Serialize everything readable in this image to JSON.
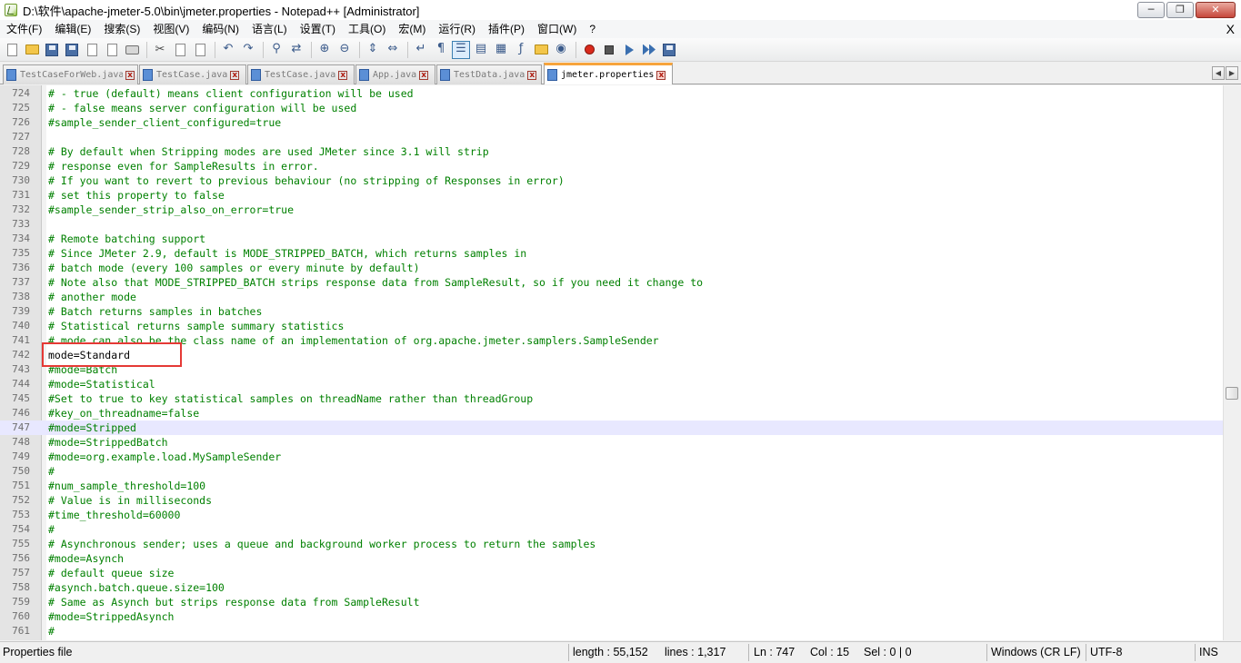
{
  "window": {
    "title": "D:\\软件\\apache-jmeter-5.0\\bin\\jmeter.properties - Notepad++ [Administrator]",
    "minimize": "─",
    "maximize": "❐",
    "close": "✕"
  },
  "menu": {
    "items": [
      "文件(F)",
      "编辑(E)",
      "搜索(S)",
      "视图(V)",
      "编码(N)",
      "语言(L)",
      "设置(T)",
      "工具(O)",
      "宏(M)",
      "运行(R)",
      "插件(P)",
      "窗口(W)",
      "?"
    ],
    "close_doc": "X"
  },
  "tabs": [
    {
      "label": "TestCaseForWeb.java",
      "active": false
    },
    {
      "label": "TestCase.java",
      "active": false
    },
    {
      "label": "TestCase.java",
      "active": false
    },
    {
      "label": "App.java",
      "active": false
    },
    {
      "label": "TestData.java",
      "active": false
    },
    {
      "label": "jmeter.properties",
      "active": true
    }
  ],
  "tab_nav": {
    "prev": "◀",
    "next": "▶"
  },
  "editor": {
    "current_line": "747",
    "highlighted_line": "742",
    "lines": [
      {
        "n": "724",
        "t": "# - true (default) means client configuration will be used"
      },
      {
        "n": "725",
        "t": "# - false means server configuration will be used"
      },
      {
        "n": "726",
        "t": "#sample_sender_client_configured=true"
      },
      {
        "n": "727",
        "t": ""
      },
      {
        "n": "728",
        "t": "# By default when Stripping modes are used JMeter since 3.1 will strip"
      },
      {
        "n": "729",
        "t": "# response even for SampleResults in error."
      },
      {
        "n": "730",
        "t": "# If you want to revert to previous behaviour (no stripping of Responses in error)"
      },
      {
        "n": "731",
        "t": "# set this property to false"
      },
      {
        "n": "732",
        "t": "#sample_sender_strip_also_on_error=true"
      },
      {
        "n": "733",
        "t": ""
      },
      {
        "n": "734",
        "t": "# Remote batching support"
      },
      {
        "n": "735",
        "t": "# Since JMeter 2.9, default is MODE_STRIPPED_BATCH, which returns samples in"
      },
      {
        "n": "736",
        "t": "# batch mode (every 100 samples or every minute by default)"
      },
      {
        "n": "737",
        "t": "# Note also that MODE_STRIPPED_BATCH strips response data from SampleResult, so if you need it change to"
      },
      {
        "n": "738",
        "t": "# another mode"
      },
      {
        "n": "739",
        "t": "# Batch returns samples in batches"
      },
      {
        "n": "740",
        "t": "# Statistical returns sample summary statistics"
      },
      {
        "n": "741",
        "t": "# mode can also be the class name of an implementation of org.apache.jmeter.samplers.SampleSender"
      },
      {
        "n": "742",
        "t": "mode=Standard"
      },
      {
        "n": "743",
        "t": "#mode=Batch"
      },
      {
        "n": "744",
        "t": "#mode=Statistical"
      },
      {
        "n": "745",
        "t": "#Set to true to key statistical samples on threadName rather than threadGroup"
      },
      {
        "n": "746",
        "t": "#key_on_threadname=false"
      },
      {
        "n": "747",
        "t": "#mode=Stripped"
      },
      {
        "n": "748",
        "t": "#mode=StrippedBatch"
      },
      {
        "n": "749",
        "t": "#mode=org.example.load.MySampleSender"
      },
      {
        "n": "750",
        "t": "#"
      },
      {
        "n": "751",
        "t": "#num_sample_threshold=100"
      },
      {
        "n": "752",
        "t": "# Value is in milliseconds"
      },
      {
        "n": "753",
        "t": "#time_threshold=60000"
      },
      {
        "n": "754",
        "t": "#"
      },
      {
        "n": "755",
        "t": "# Asynchronous sender; uses a queue and background worker process to return the samples"
      },
      {
        "n": "756",
        "t": "#mode=Asynch"
      },
      {
        "n": "757",
        "t": "# default queue size"
      },
      {
        "n": "758",
        "t": "#asynch.batch.queue.size=100"
      },
      {
        "n": "759",
        "t": "# Same as Asynch but strips response data from SampleResult"
      },
      {
        "n": "760",
        "t": "#mode=StrippedAsynch"
      },
      {
        "n": "761",
        "t": "#"
      }
    ]
  },
  "status": {
    "file_type": "Properties file",
    "length": "length : 55,152",
    "lines": "lines : 1,317",
    "ln": "Ln : 747",
    "col": "Col : 15",
    "sel": "Sel : 0 | 0",
    "eol": "Windows (CR LF)",
    "encoding": "UTF-8",
    "mode": "INS"
  },
  "colors": {
    "comment": "#008000",
    "current_line_bg": "#e8e8ff",
    "highlight_box": "#e53935",
    "active_tab_accent": "#f7a43c"
  }
}
